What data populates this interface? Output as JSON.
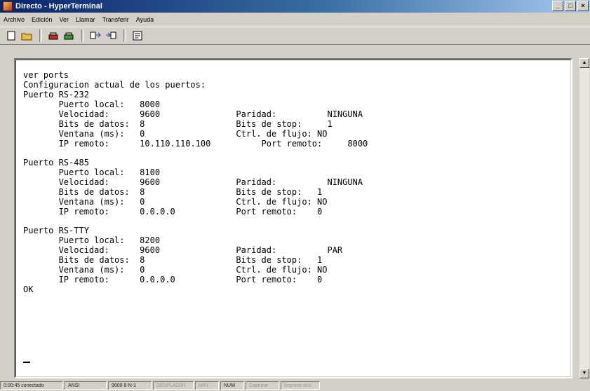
{
  "window": {
    "title": "Directo - HyperTerminal",
    "minimize": "_",
    "maximize": "□",
    "close": "×"
  },
  "menu": [
    "Archivo",
    "Edición",
    "Ver",
    "Llamar",
    "Transferir",
    "Ayuda"
  ],
  "toolbar": [
    "new-icon",
    "open-icon",
    "connect-icon",
    "disconnect-icon",
    "send-icon",
    "receive-icon",
    "properties-icon"
  ],
  "terminal": {
    "lines": [
      "ver ports",
      "Configuracion actual de los puertos:",
      "Puerto RS-232",
      "       Puerto local:   8000",
      "       Velocidad:      9600               Paridad:          NINGUNA",
      "       Bits de datos:  8                  Bits de stop:     1",
      "       Ventana (ms):   0                  Ctrl. de flujo: NO",
      "       IP remoto:      10.110.110.100          Port remoto:     8000",
      "Puerto RS-485",
      "       Puerto local:   8100",
      "       Velocidad:      9600               Paridad:          NINGUNA",
      "       Bits de datos:  8                  Bits de stop:   1",
      "       Ventana (ms):   0                  Ctrl. de flujo: NO",
      "       IP remoto:      0.0.0.0            Port remoto:    0",
      "Puerto RS-TTY",
      "       Puerto local:   8200",
      "       Velocidad:      9600               Paridad:          PAR",
      "       Bits de datos:  8                  Bits de stop:   1",
      "       Ventana (ms):   0                  Ctrl. de flujo: NO",
      "       IP remoto:      0.0.0.0            Port remoto:    0",
      "OK"
    ]
  },
  "status": {
    "connection": "0:00:45 conectado",
    "emulation": "ANSI",
    "settings": "9600 8-N-1",
    "scroll": "DESPLAZAR",
    "caps": "MAY",
    "num": "NUM",
    "capture": "Capturar",
    "echo": "Imprimir eco"
  }
}
